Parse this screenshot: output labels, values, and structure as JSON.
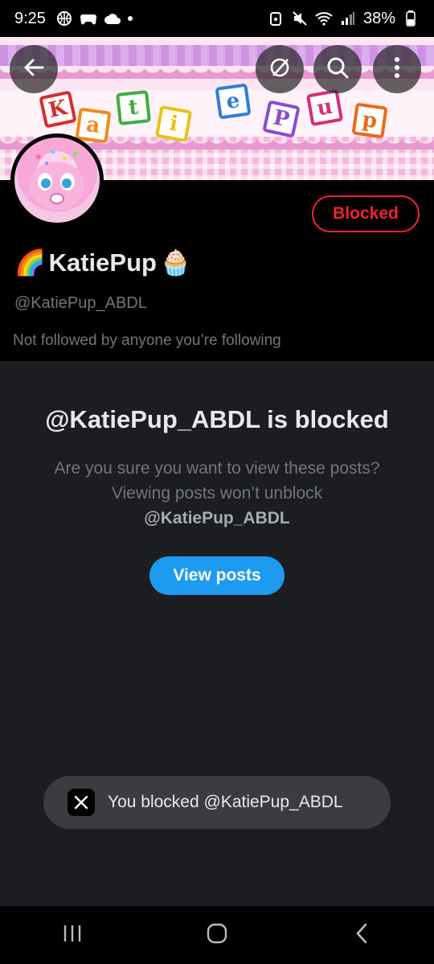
{
  "status_bar": {
    "time": "9:25",
    "battery": "38%",
    "left_icons": [
      "basketball-icon",
      "gamepad-icon",
      "cloud-icon",
      "dot"
    ],
    "right_icons": [
      "alarm-icon",
      "mute-icon",
      "wifi-icon",
      "signal-icon",
      "battery-icon"
    ]
  },
  "banner": {
    "letters": [
      "K",
      "a",
      "t",
      "i",
      "e",
      "P",
      "u",
      "p"
    ],
    "letter_colors": [
      "#d92b2b",
      "#f08a1c",
      "#3fae3f",
      "#e8c21a",
      "#2f7ed8",
      "#8a4bd0",
      "#d92b7c",
      "#e86a1c"
    ]
  },
  "header": {
    "back_icon": "back-arrow-icon",
    "refresh_icon": "refresh-icon",
    "search_icon": "search-icon",
    "more_icon": "more-vertical-icon"
  },
  "profile": {
    "blocked_label": "Blocked",
    "name_prefix_emoji": "🌈",
    "name": "KatiePup",
    "name_suffix_emoji": "🧁",
    "handle": "@KatiePup_ABDL",
    "followed_text": "Not followed by anyone you’re following"
  },
  "blocked_panel": {
    "title": "@KatiePup_ABDL is blocked",
    "body": "Are you sure you want to view these posts? Viewing posts won’t unblock",
    "body_handle": "@KatiePup_ABDL",
    "button_label": "View posts"
  },
  "toast": {
    "text": "You blocked @KatiePup_ABDL"
  },
  "colors": {
    "accent_blue": "#1d9bf0",
    "blocked_red": "#f4212e",
    "panel_bg": "#1b1d21"
  },
  "navbar": {
    "items": [
      "recent-apps-icon",
      "home-icon",
      "back-icon"
    ]
  }
}
